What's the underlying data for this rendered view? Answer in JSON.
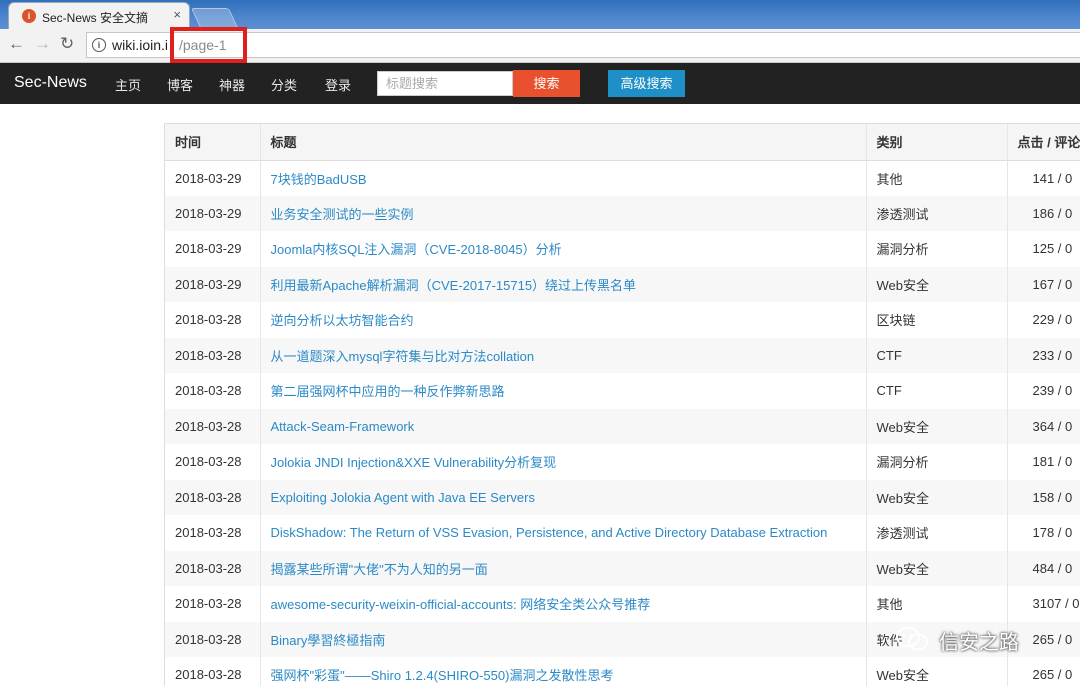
{
  "browser": {
    "tab_title": "Sec-News 安全文摘",
    "tab_close": "×",
    "url_host": "wiki.ioin.i",
    "url_path": "/page-1"
  },
  "navbar": {
    "brand": "Sec-News",
    "links": [
      "主页",
      "博客",
      "神器",
      "分类",
      "登录"
    ],
    "search_placeholder": "标题搜索",
    "search_button": "搜索",
    "advanced_button": "高级搜索"
  },
  "table": {
    "headers": [
      "时间",
      "标题",
      "类别",
      "点击 / 评论"
    ],
    "rows": [
      {
        "date": "2018-03-29",
        "title": "7块钱的BadUSB",
        "category": "其他",
        "clicks": "141 / 0"
      },
      {
        "date": "2018-03-29",
        "title": "业务安全测试的一些实例",
        "category": "渗透测试",
        "clicks": "186 / 0"
      },
      {
        "date": "2018-03-29",
        "title": "Joomla内核SQL注入漏洞（CVE-2018-8045）分析",
        "category": "漏洞分析",
        "clicks": "125 / 0"
      },
      {
        "date": "2018-03-29",
        "title": "利用最新Apache解析漏洞（CVE-2017-15715）绕过上传黑名单",
        "category": "Web安全",
        "clicks": "167 / 0"
      },
      {
        "date": "2018-03-28",
        "title": "逆向分析以太坊智能合约",
        "category": "区块链",
        "clicks": "229 / 0"
      },
      {
        "date": "2018-03-28",
        "title": "从一道题深入mysql字符集与比对方法collation",
        "category": "CTF",
        "clicks": "233 / 0"
      },
      {
        "date": "2018-03-28",
        "title": "第二届强网杯中应用的一种反作弊新思路",
        "category": "CTF",
        "clicks": "239 / 0"
      },
      {
        "date": "2018-03-28",
        "title": "Attack-Seam-Framework",
        "category": "Web安全",
        "clicks": "364 / 0"
      },
      {
        "date": "2018-03-28",
        "title": "Jolokia JNDI Injection&XXE Vulnerability分析复现",
        "category": "漏洞分析",
        "clicks": "181 / 0"
      },
      {
        "date": "2018-03-28",
        "title": "Exploiting Jolokia Agent with Java EE Servers",
        "category": "Web安全",
        "clicks": "158 / 0"
      },
      {
        "date": "2018-03-28",
        "title": "DiskShadow: The Return of VSS Evasion, Persistence, and Active Directory Database Extraction",
        "category": "渗透测试",
        "clicks": "178 / 0"
      },
      {
        "date": "2018-03-28",
        "title": "揭露某些所谓\"大佬\"不为人知的另一面",
        "category": "Web安全",
        "clicks": "484 / 0"
      },
      {
        "date": "2018-03-28",
        "title": "awesome-security-weixin-official-accounts: 网络安全类公众号推荐",
        "category": "其他",
        "clicks": "3107 / 0"
      },
      {
        "date": "2018-03-28",
        "title": "Binary學習終極指南",
        "category": "软件",
        "clicks": "265 / 0"
      },
      {
        "date": "2018-03-28",
        "title": "强网杯\"彩蛋\"——Shiro 1.2.4(SHIRO-550)漏洞之发散性思考",
        "category": "Web安全",
        "clicks": "265 / 0"
      }
    ]
  },
  "watermark": {
    "text": "信安之路",
    "icon": "wechat-icon"
  },
  "colors": {
    "navbar_bg": "#222222",
    "search_button": "#e9502d",
    "advanced_button": "#1f8fc7",
    "link": "#2b8ac6",
    "highlight_box": "#e0201c"
  }
}
